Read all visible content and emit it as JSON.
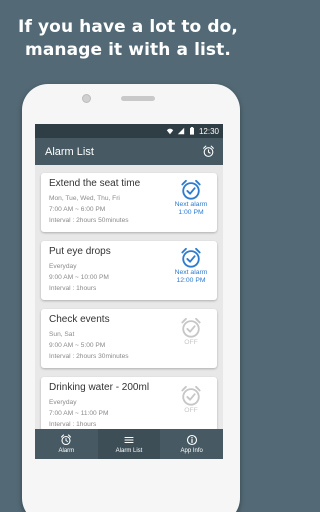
{
  "promo": {
    "line1": "If you have a lot to do,",
    "line2": "manage it with a list."
  },
  "statusbar": {
    "time": "12:30"
  },
  "appbar": {
    "title": "Alarm List",
    "icon": "alarm-clock-icon"
  },
  "colors": {
    "background": "#536a76",
    "appbar": "#475a64",
    "statusbar": "#2f3d44",
    "accent": "#2e7bd0",
    "off": "#c7c7c7"
  },
  "alarms": [
    {
      "title": "Extend the seat time",
      "days": "Mon, Tue, Wed, Thu, Fri",
      "time_range": "7:00 AM ~ 6:00 PM",
      "interval": "Interval : 2hours 50minutes",
      "status": "active",
      "badge_label": "Next alarm",
      "badge_time": "1:00 PM"
    },
    {
      "title": "Put eye drops",
      "days": "Everyday",
      "time_range": "9:00 AM ~ 10:00 PM",
      "interval": "Interval : 1hours",
      "status": "active",
      "badge_label": "Next alarm",
      "badge_time": "12:00 PM"
    },
    {
      "title": "Check events",
      "days": "Sun, Sat",
      "time_range": "9:00 AM ~ 5:00 PM",
      "interval": "Interval : 2hours 30minutes",
      "status": "off",
      "badge_label": "OFF",
      "badge_time": ""
    },
    {
      "title": "Drinking water - 200ml",
      "days": "Everyday",
      "time_range": "7:00 AM ~ 11:00 PM",
      "interval": "Interval : 1hours",
      "status": "off",
      "badge_label": "OFF",
      "badge_time": ""
    }
  ],
  "bottomnav": {
    "items": [
      {
        "label": "Alarm",
        "icon": "alarm-clock-icon"
      },
      {
        "label": "Alarm List",
        "icon": "list-icon",
        "selected": true
      },
      {
        "label": "App Info",
        "icon": "info-icon"
      }
    ]
  }
}
